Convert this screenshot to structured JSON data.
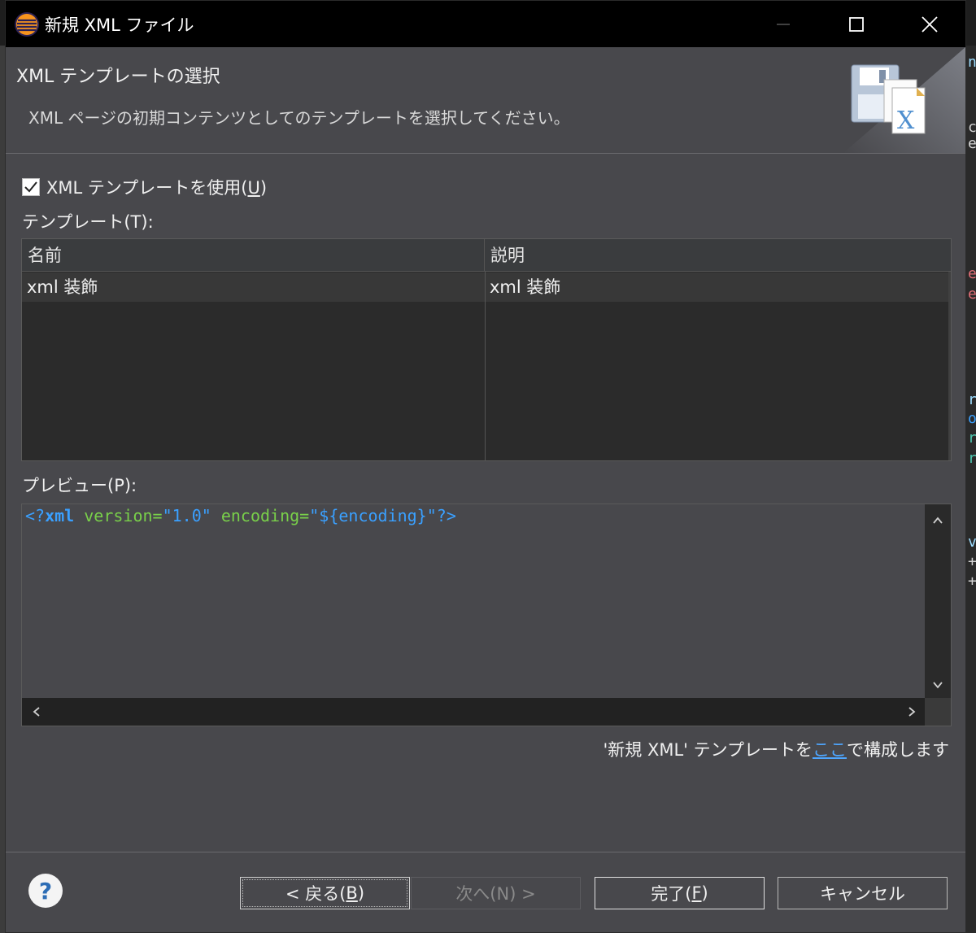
{
  "window": {
    "title": "新規 XML ファイル"
  },
  "header": {
    "title": "XML テンプレートの選択",
    "description": "XML ページの初期コンテンツとしてのテンプレートを選択してください。"
  },
  "use_template": {
    "label_prefix": "XML テンプレートを使用(",
    "mnemonic": "U",
    "label_suffix": ")",
    "checked": true
  },
  "templates": {
    "label": "テンプレート(T):",
    "columns": [
      "名前",
      "説明"
    ],
    "rows": [
      {
        "name": "xml 装飾",
        "description": "xml 装飾"
      }
    ]
  },
  "preview": {
    "label": "プレビュー(P):",
    "code": {
      "open": "<?",
      "tag": "xml",
      "attr1": " version=",
      "val1": "\"1.0\"",
      "attr2": " encoding=",
      "val2": "\"${encoding}\"",
      "close": "?>"
    }
  },
  "config": {
    "prefix": "'新規 XML' テンプレートを",
    "link": "ここ",
    "suffix": "で構成します"
  },
  "buttons": {
    "back_prefix": "< 戻る(",
    "back_mnemonic": "B",
    "back_suffix": ")",
    "next": "次へ(N) >",
    "finish_prefix": "完了(",
    "finish_mnemonic": "F",
    "finish_suffix": ")",
    "cancel": "キャンセル",
    "help": "?"
  },
  "colors": {
    "titlebar": "#000000",
    "dialog_bg": "#48484c",
    "link": "#4ea6ff",
    "code_tag": "#3aa0ff",
    "code_attr": "#79d04a"
  }
}
